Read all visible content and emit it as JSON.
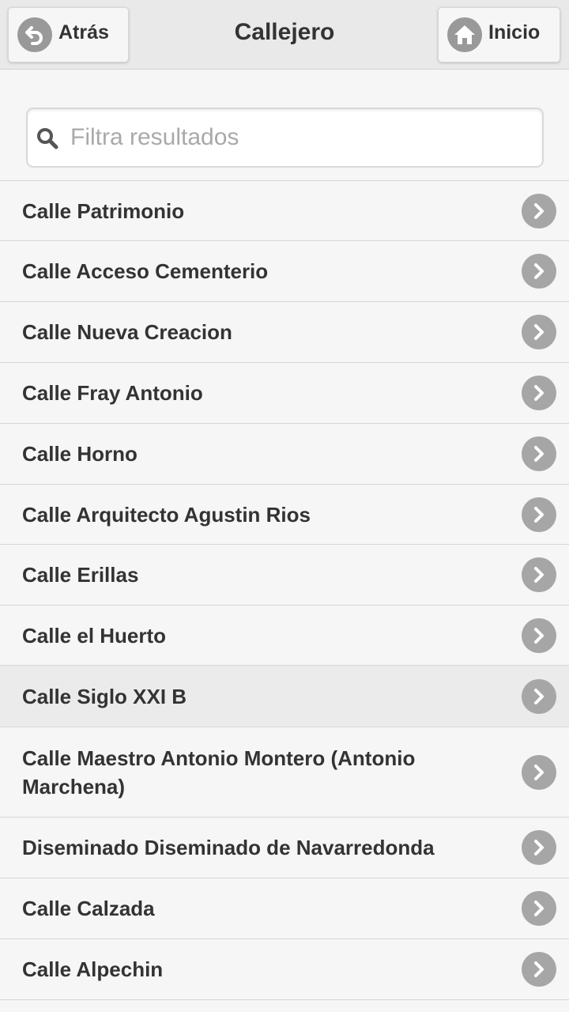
{
  "header": {
    "title": "Callejero",
    "back_label": "Atrás",
    "home_label": "Inicio"
  },
  "search": {
    "placeholder": "Filtra resultados",
    "value": ""
  },
  "streets": [
    "Calle Patrimonio",
    "Calle Acceso Cementerio",
    "Calle Nueva Creacion",
    "Calle Fray Antonio",
    "Calle Horno",
    "Calle Arquitecto Agustin Rios",
    "Calle Erillas",
    "Calle el Huerto",
    "Calle Siglo XXI B",
    "Calle Maestro Antonio Montero (Antonio Marchena)",
    "Diseminado Diseminado de Navarredonda",
    "Calle Calzada",
    "Calle Alpechin"
  ],
  "highlighted_index": 8,
  "icons": {
    "back": "back-arrow-icon",
    "home": "home-icon",
    "search": "search-icon",
    "item": "chevron-right-icon"
  },
  "colors": {
    "header_bg": "#e9e9e9",
    "page_bg": "#f6f6f6",
    "text": "#333333",
    "icon_circle": "#999999",
    "highlight_bg": "#ebebeb"
  }
}
